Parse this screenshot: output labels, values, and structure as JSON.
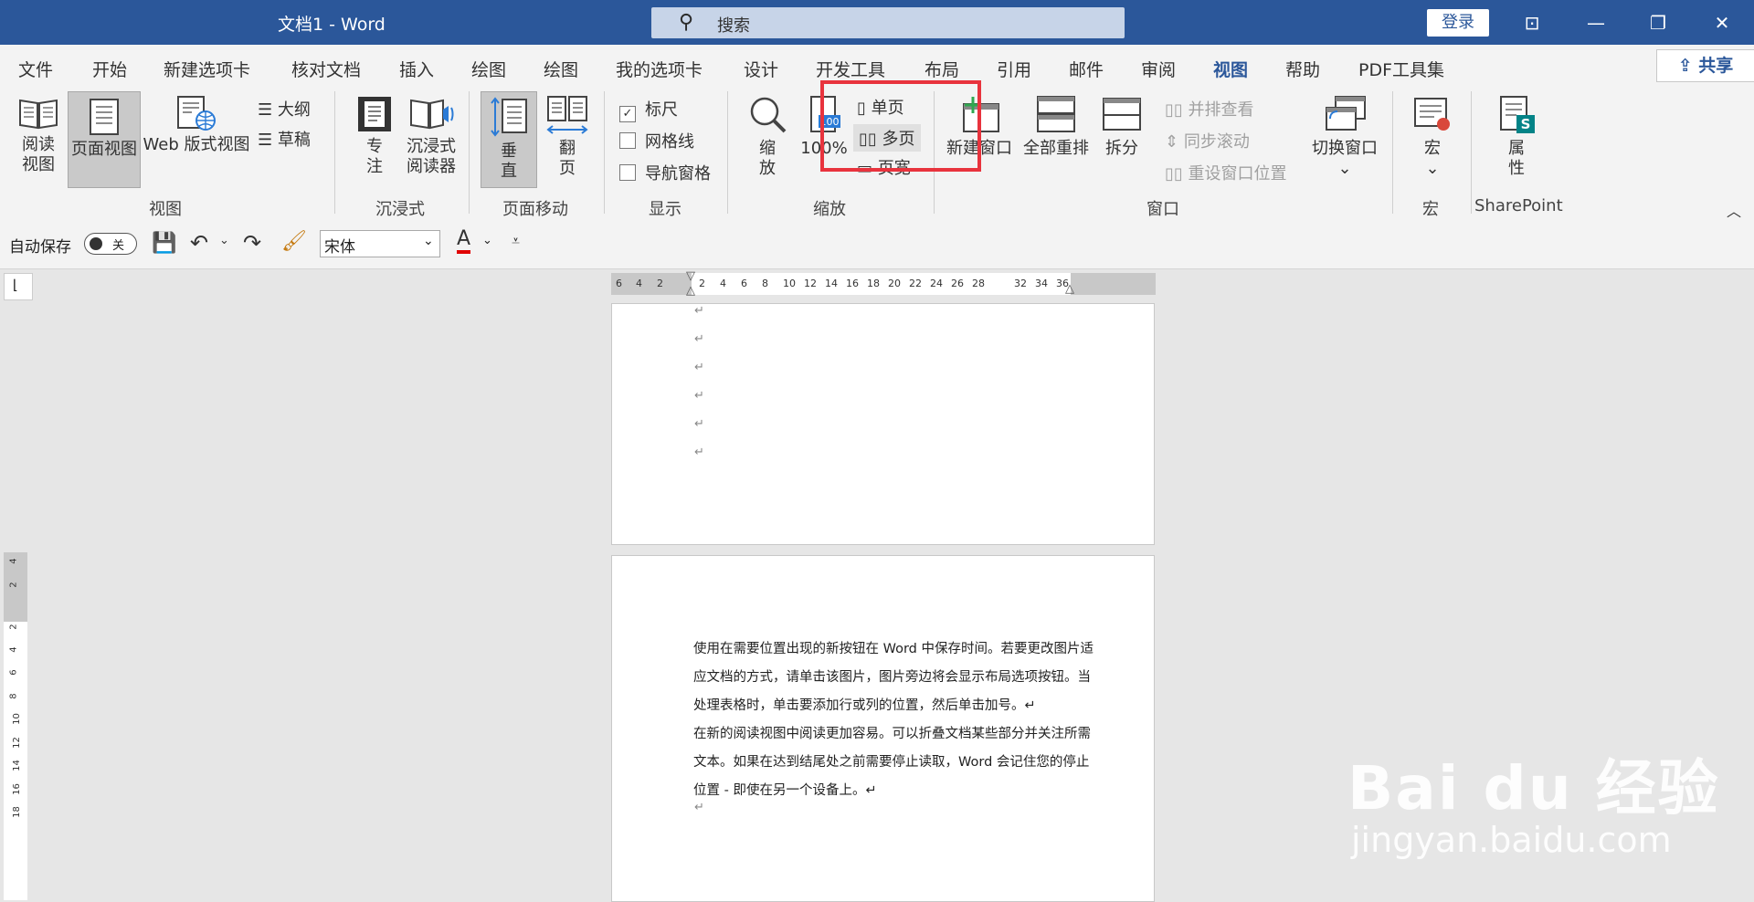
{
  "titlebar": {
    "title": "文档1  -  Word",
    "search_placeholder": "搜索",
    "login": "登录",
    "controls": [
      "⊡",
      "—",
      "❐",
      "✕"
    ]
  },
  "tabs": [
    "文件",
    "开始",
    "新建选项卡",
    "核对文档",
    "插入",
    "绘图",
    "绘图",
    "我的选项卡",
    "设计",
    "开发工具",
    "布局",
    "引用",
    "邮件",
    "审阅",
    "视图",
    "帮助",
    "PDF工具集"
  ],
  "active_tab": "视图",
  "share_label": "共享",
  "ribbon": {
    "views": {
      "read_line1": "阅读",
      "read_line2": "视图",
      "print": "页面视图",
      "web": "Web 版式视图",
      "outline": "大纲",
      "draft": "草稿",
      "label": "视图"
    },
    "immersive": {
      "focus_line1": "专",
      "focus_line2": "注",
      "reader_line1": "沉浸式",
      "reader_line2": "阅读器",
      "label": "沉浸式"
    },
    "page_move": {
      "vertical_line1": "垂",
      "vertical_line2": "直",
      "side_line1": "翻",
      "side_line2": "页",
      "label": "页面移动"
    },
    "show": {
      "ruler": "标尺",
      "ruler_checked": true,
      "gridlines": "网格线",
      "gridlines_checked": false,
      "navpane": "导航窗格",
      "navpane_checked": false,
      "label": "显示"
    },
    "zoom": {
      "zoom_line1": "缩",
      "zoom_line2": "放",
      "hundred": "100%",
      "hundred_icon": "100",
      "one_page": "单页",
      "multi_page": "多页",
      "page_width": "页宽",
      "label": "缩放"
    },
    "window": {
      "new_window": "新建窗口",
      "arrange_all": "全部重排",
      "split": "拆分",
      "side_by_side": "并排查看",
      "sync_scroll": "同步滚动",
      "reset_pos": "重设窗口位置",
      "switch": "切换窗口",
      "label": "窗口"
    },
    "macros": {
      "macro": "宏",
      "label": "宏"
    },
    "sharepoint": {
      "props_line1": "属",
      "props_line2": "性",
      "label": "SharePoint"
    }
  },
  "qat": {
    "autosave": "自动保存",
    "toggle": "关",
    "font": "宋体",
    "font_color_letter": "A"
  },
  "ruler_h_ticks": [
    "6",
    "4",
    "2",
    "2",
    "4",
    "6",
    "8",
    "10",
    "12",
    "14",
    "16",
    "18",
    "20",
    "22",
    "24",
    "26",
    "28",
    "32",
    "34",
    "36"
  ],
  "ruler_v_ticks": [
    "4",
    "2",
    "2",
    "4",
    "6",
    "8",
    "10",
    "12",
    "14",
    "16",
    "18"
  ],
  "document": {
    "para_mark": "↵",
    "lines": [
      "使用在需要位置出现的新按钮在 Word 中保存时间。若要更改图片适",
      "应文档的方式，请单击该图片，图片旁边将会显示布局选项按钮。当",
      "处理表格时，单击要添加行或列的位置，然后单击加号。↵",
      "在新的阅读视图中阅读更加容易。可以折叠文档某些部分并关注所需",
      "文本。如果在达到结尾处之前需要停止读取，Word 会记住您的停止",
      "位置 - 即使在另一个设备上。↵"
    ]
  },
  "watermark": {
    "brand": "Bai du 经验",
    "url": "jingyan.baidu.com"
  },
  "colors": {
    "brand_blue": "#2b579a",
    "highlight_red": "#e8333d"
  }
}
